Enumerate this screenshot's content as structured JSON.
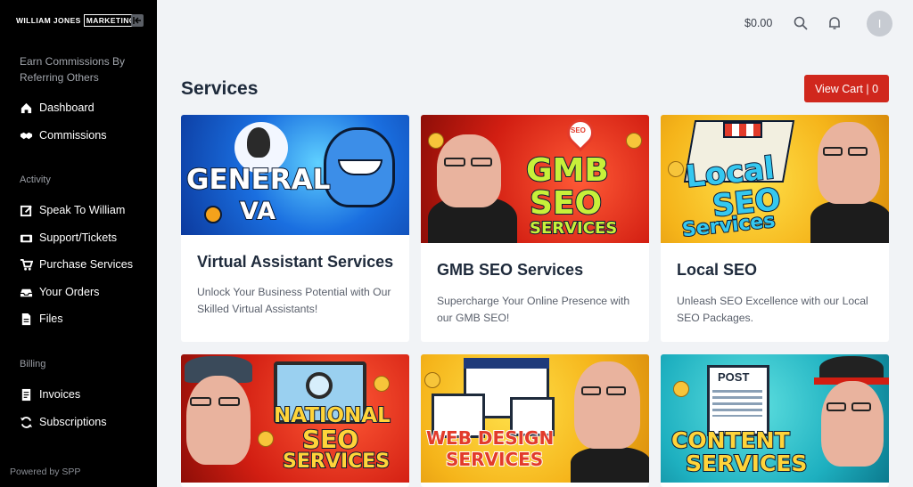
{
  "brand": {
    "name": "WILLIAM JONES",
    "boxed": "MARKETING"
  },
  "sidebar": {
    "promo": "Earn Commissions By Referring Others",
    "items_top": [
      {
        "label": "Dashboard",
        "icon": "home-icon"
      },
      {
        "label": "Commissions",
        "icon": "handshake-icon"
      }
    ],
    "section_activity": "Activity",
    "items_activity": [
      {
        "label": "Speak To William",
        "icon": "edit-icon"
      },
      {
        "label": "Support/Tickets",
        "icon": "tickets-icon"
      },
      {
        "label": "Purchase Services",
        "icon": "cart-icon"
      },
      {
        "label": "Your Orders",
        "icon": "inbox-icon"
      },
      {
        "label": "Files",
        "icon": "file-icon"
      }
    ],
    "section_billing": "Billing",
    "items_billing": [
      {
        "label": "Invoices",
        "icon": "invoice-icon"
      },
      {
        "label": "Subscriptions",
        "icon": "refresh-icon"
      }
    ],
    "powered_by": "Powered by SPP"
  },
  "topbar": {
    "balance": "$0.00",
    "avatar_initial": "I"
  },
  "main": {
    "title": "Services",
    "cart_button": "View Cart | 0",
    "cards": [
      {
        "title": "Virtual Assistant Services",
        "desc": "Unlock Your Business Potential with Our Skilled Virtual Assistants!",
        "img_line1": "GENERAL",
        "img_line2": "VA"
      },
      {
        "title": "GMB SEO Services",
        "desc": "Supercharge Your Online Presence with our GMB SEO!",
        "img_line1": "GMB",
        "img_line2": "SEO",
        "img_line3": "SERVICES",
        "pin_text": "SEO"
      },
      {
        "title": "Local SEO",
        "desc": "Unleash SEO Excellence with our Local SEO Packages.",
        "img_line1": "Local",
        "img_line2": "SEO",
        "img_line3": "Services"
      },
      {
        "img_line1": "NATIONAL",
        "img_line2": "SEO",
        "img_line3": "SERVICES"
      },
      {
        "img_line1": "WEB DESIGN",
        "img_line2": "SERVICES"
      },
      {
        "img_line1": "CONTENT",
        "img_line2": "SERVICES",
        "doc_label": "POST"
      }
    ]
  },
  "colors": {
    "sidebar": "#000000",
    "accent": "#d0271d",
    "background": "#f1f3f6"
  }
}
